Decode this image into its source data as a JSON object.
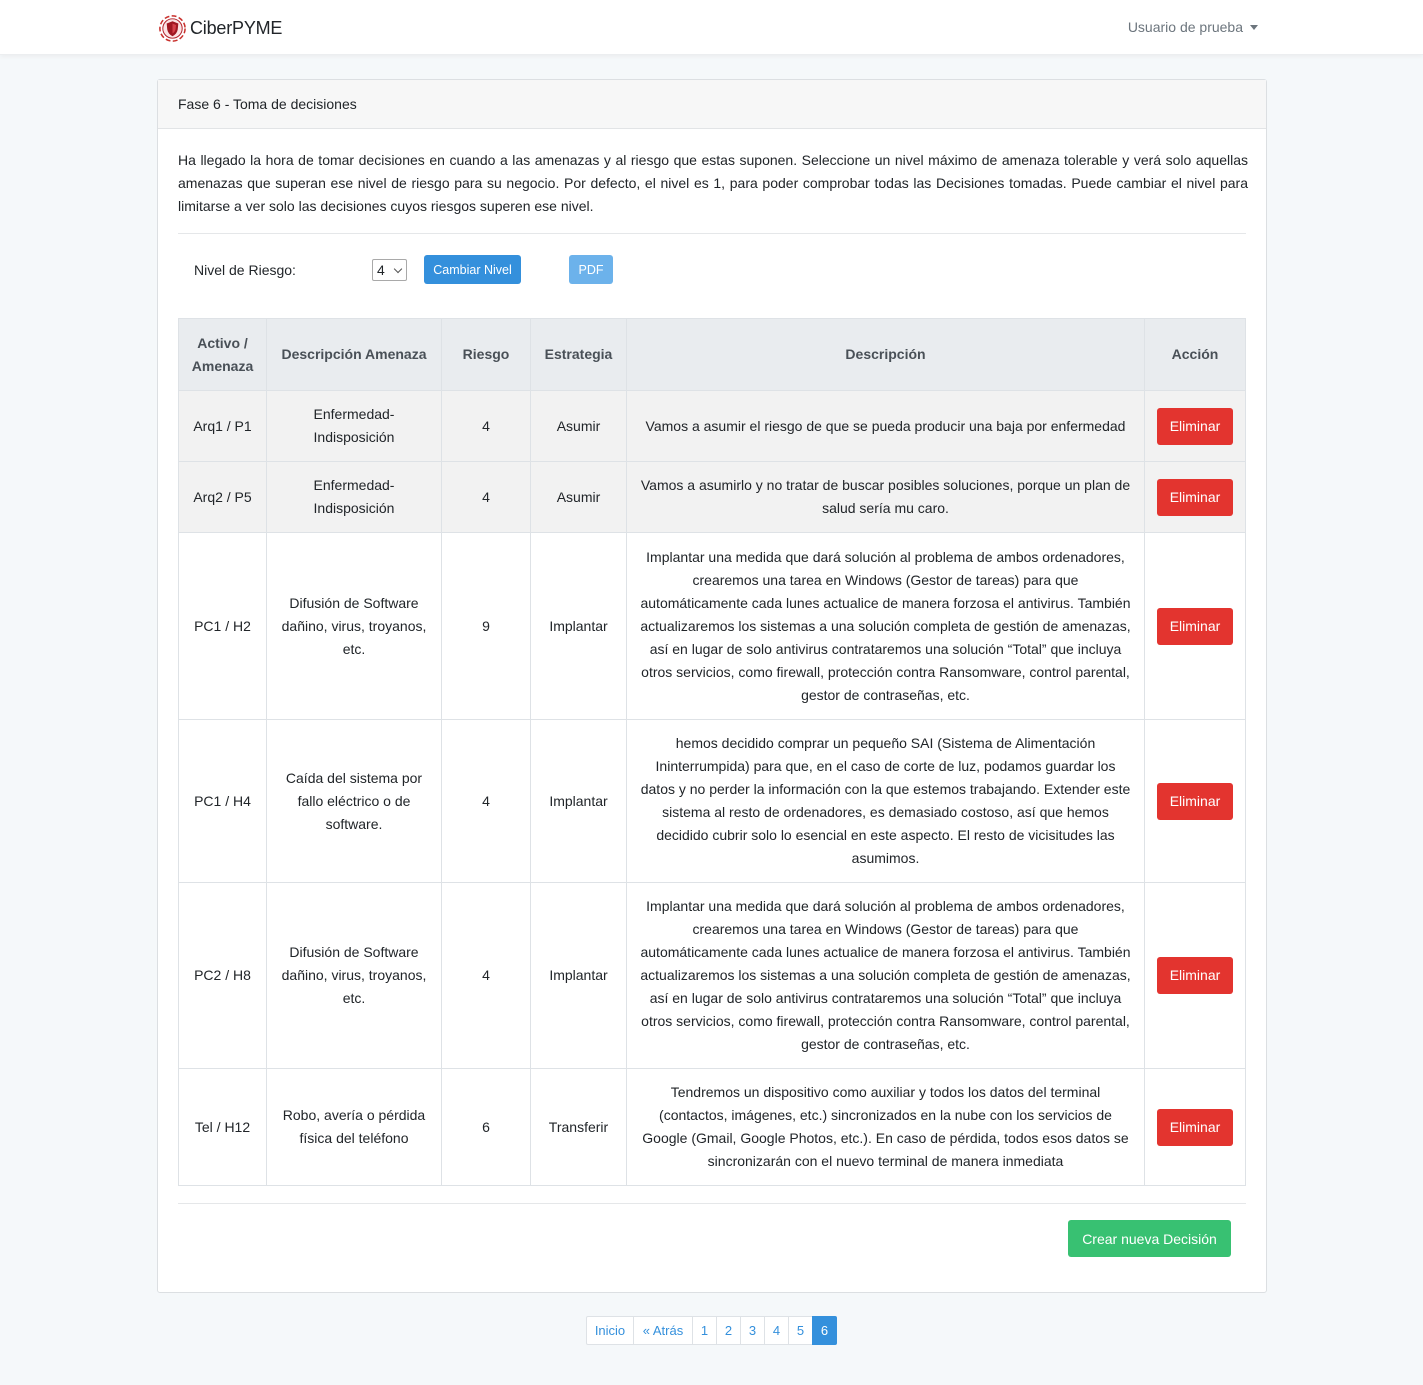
{
  "nav": {
    "brand": "CiberPYME",
    "user": "Usuario de prueba"
  },
  "card": {
    "title": "Fase 6 - Toma de decisiones",
    "intro": "Ha llegado la hora de tomar decisiones en cuando a las amenazas y al riesgo que estas suponen. Seleccione un nivel máximo de amenaza tolerable y verá solo aquellas amenazas que superan ese nivel de riesgo para su negocio. Por defecto, el nivel es 1, para poder comprobar todas las Decisiones tomadas. Puede cambiar el nivel para limitarse a ver solo las decisiones cuyos riesgos superen ese nivel."
  },
  "controls": {
    "nivel_label": "Nivel de Riesgo:",
    "nivel_value": "4",
    "cambiar_label": "Cambiar Nivel",
    "pdf_label": "PDF"
  },
  "table": {
    "headers": [
      "Activo / Amenaza",
      "Descripción Amenaza",
      "Riesgo",
      "Estrategia",
      "Descripción",
      "Acción"
    ],
    "delete_label": "Eliminar",
    "rows": [
      {
        "activo": "Arq1 / P1",
        "amenaza": "Enfermedad-Indisposición",
        "riesgo": "4",
        "estrategia": "Asumir",
        "descripcion": "Vamos a asumir el riesgo de que se pueda producir una baja por enfermedad"
      },
      {
        "activo": "Arq2 / P5",
        "amenaza": "Enfermedad-Indisposición",
        "riesgo": "4",
        "estrategia": "Asumir",
        "descripcion": "Vamos a asumirlo y no tratar de buscar posibles soluciones, porque un plan de salud sería mu caro."
      },
      {
        "activo": "PC1 / H2",
        "amenaza": "Difusión de Software dañino, virus, troyanos, etc.",
        "riesgo": "9",
        "estrategia": "Implantar",
        "descripcion": "Implantar una medida que dará solución al problema de ambos ordenadores, crearemos una tarea en Windows (Gestor de tareas) para que automáticamente cada lunes actualice de manera forzosa el antivirus. También actualizaremos los sistemas a una solución completa de gestión de amenazas, así en lugar de solo antivirus contrataremos una solución “Total” que incluya otros servicios, como firewall, protección contra Ransomware, control parental, gestor de contraseñas, etc."
      },
      {
        "activo": "PC1 / H4",
        "amenaza": "Caída del sistema por fallo eléctrico o de software.",
        "riesgo": "4",
        "estrategia": "Implantar",
        "descripcion": "hemos decidido comprar un pequeño SAI (Sistema de Alimentación Ininterrumpida) para que, en el caso de corte de luz, podamos guardar los datos y no perder la información con la que estemos trabajando. Extender este sistema al resto de ordenadores, es demasiado costoso, así que hemos decidido cubrir solo lo esencial en este aspecto. El resto de vicisitudes las asumimos."
      },
      {
        "activo": "PC2 / H8",
        "amenaza": "Difusión de Software dañino, virus, troyanos, etc.",
        "riesgo": "4",
        "estrategia": "Implantar",
        "descripcion": "Implantar una medida que dará solución al problema de ambos ordenadores, crearemos una tarea en Windows (Gestor de tareas) para que automáticamente cada lunes actualice de manera forzosa el antivirus. También actualizaremos los sistemas a una solución completa de gestión de amenazas, así en lugar de solo antivirus contrataremos una solución “Total” que incluya otros servicios, como firewall, protección contra Ransomware, control parental, gestor de contraseñas, etc."
      },
      {
        "activo": "Tel / H12",
        "amenaza": "Robo, avería o pérdida física del teléfono",
        "riesgo": "6",
        "estrategia": "Transferir",
        "descripcion": "Tendremos un dispositivo como auxiliar y todos los datos del terminal (contactos, imágenes, etc.) sincronizados en la nube con los servicios de Google (Gmail, Google Photos, etc.). En caso de pérdida, todos esos datos se sincronizarán con el nuevo terminal de manera inmediata"
      }
    ]
  },
  "footer": {
    "crear_label": "Crear nueva Decisión"
  },
  "pagination": {
    "items": [
      "Inicio",
      "« Atrás",
      "1",
      "2",
      "3",
      "4",
      "5",
      "6"
    ],
    "active": "6"
  },
  "colors": {
    "primary": "#3490dc",
    "danger": "#e3342f",
    "success": "#38c172",
    "pdf": "#6cb2eb"
  }
}
